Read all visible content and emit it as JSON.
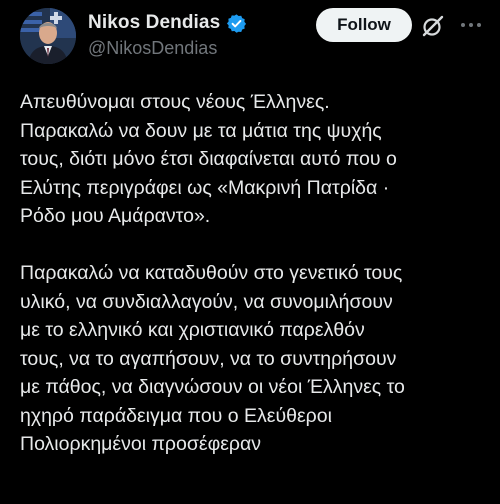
{
  "author": {
    "display_name": "Nikos Dendias",
    "handle": "@NikosDendias",
    "verified": true,
    "avatar_icon": "profile-photo"
  },
  "actions": {
    "follow_label": "Follow",
    "grok_icon": "grok-slash-icon",
    "more_icon": "more-dots-icon"
  },
  "tweet": {
    "paragraph1": [
      "Απευθύνομαι στους νέους Έλληνες.",
      "Παρακαλώ να δουν με τα μάτια της ψυχής",
      "τους, διότι μόνο έτσι διαφαίνεται αυτό που ο",
      "Ελύτης περιγράφει ως «Μακρινή Πατρίδα ·",
      "Ρόδο μου Αμάραντο»."
    ],
    "paragraph2": [
      "Παρακαλώ να καταδυθούν στο γενετικό τους",
      "υλικό, να συνδιαλλαγούν, να συνομιλήσουν",
      "με το ελληνικό και χριστιανικό παρελθόν",
      "τους, να το αγαπήσουν, να το συντηρήσουν",
      "με πάθος, να διαγνώσουν οι νέοι Έλληνες το",
      "ηχηρό παράδειγμα που ο Ελεύθεροι",
      "Πολιορκημένοι προσέφεραν"
    ]
  },
  "colors": {
    "background": "#000000",
    "text_primary": "#e7e9ea",
    "text_secondary": "#71767b",
    "verified_blue": "#1d9bf0",
    "follow_bg": "#eff3f4"
  }
}
